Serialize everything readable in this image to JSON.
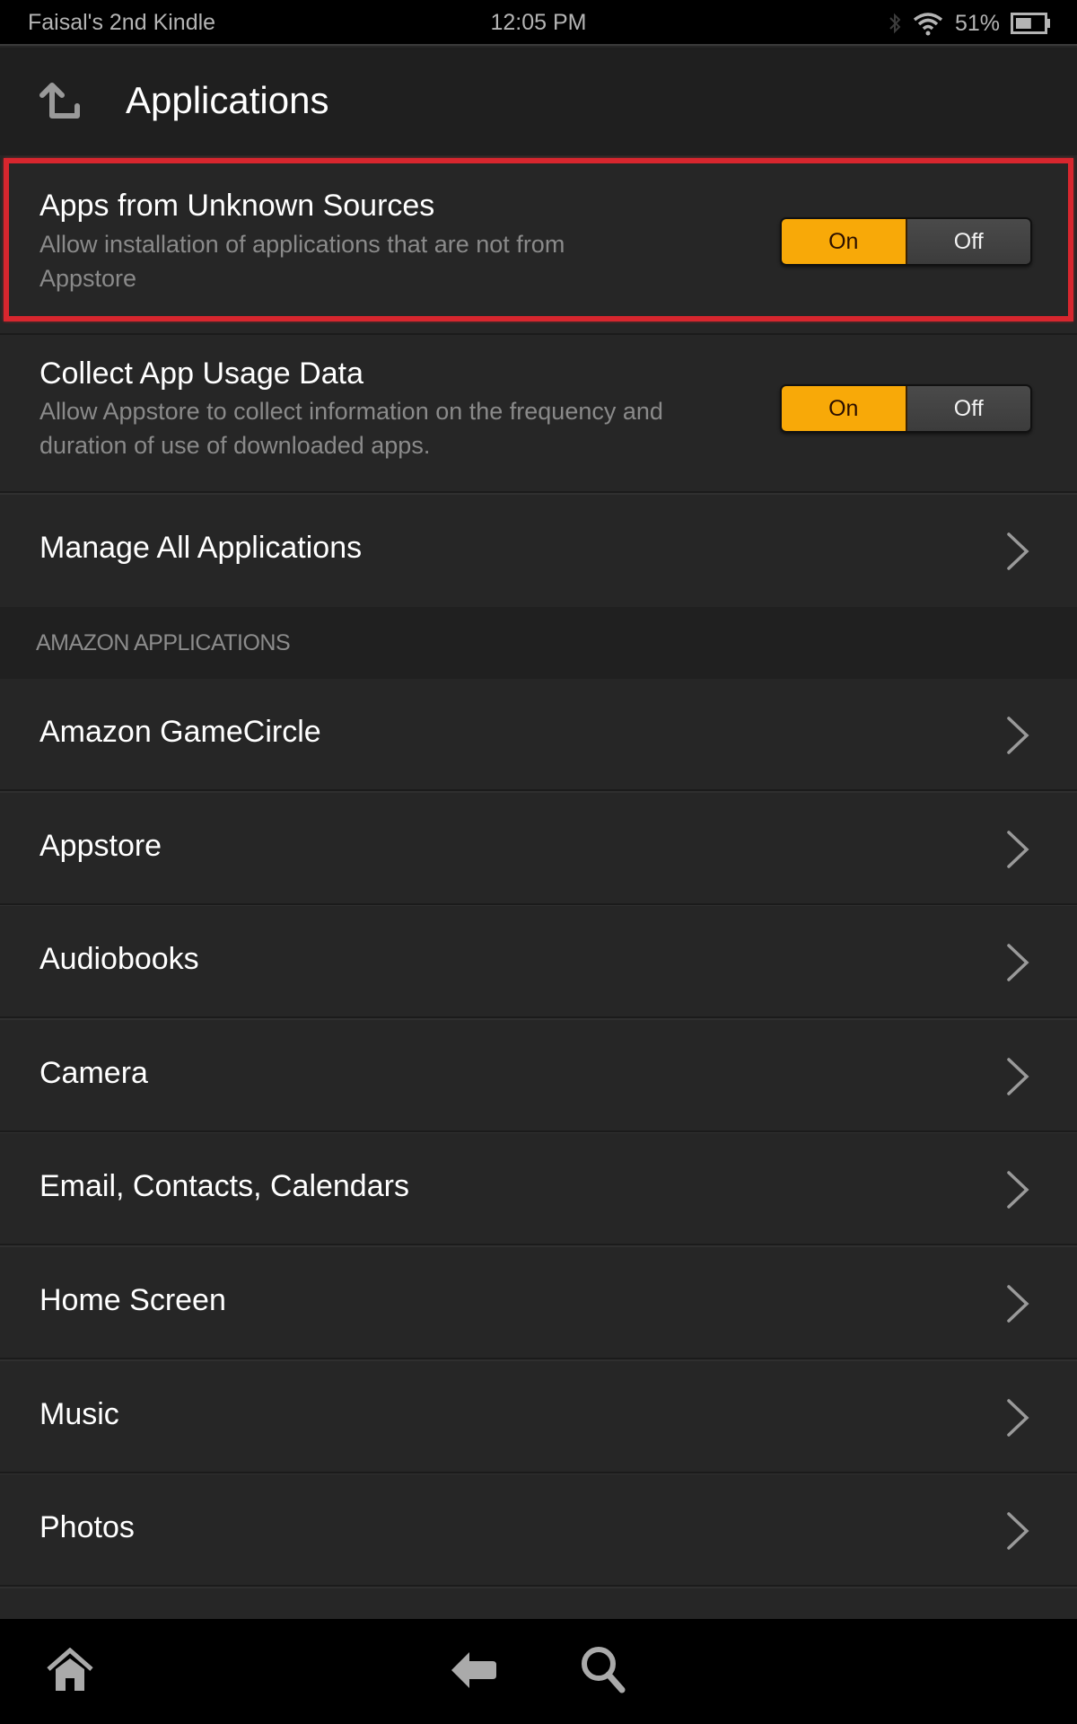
{
  "status_bar": {
    "device_name": "Faisal's 2nd Kindle",
    "time": "12:05 PM",
    "battery_percent": "51%",
    "battery_level": 0.51,
    "icons": [
      "bluetooth-icon",
      "wifi-icon",
      "battery-icon"
    ]
  },
  "header": {
    "title": "Applications",
    "up_icon": "up-arrow-icon"
  },
  "settings": [
    {
      "label": "Apps from Unknown Sources",
      "description": "Allow installation of applications that are not from Appstore",
      "toggle": {
        "on_label": "On",
        "off_label": "Off",
        "value": "On"
      },
      "highlighted": true
    },
    {
      "label": "Collect App Usage Data",
      "description": "Allow Appstore to collect information on the frequency and duration of use of downloaded apps.",
      "toggle": {
        "on_label": "On",
        "off_label": "Off",
        "value": "On"
      },
      "highlighted": false
    }
  ],
  "manage_all": {
    "label": "Manage All Applications"
  },
  "section": {
    "title": "AMAZON APPLICATIONS",
    "items": [
      {
        "label": "Amazon GameCircle"
      },
      {
        "label": "Appstore"
      },
      {
        "label": "Audiobooks"
      },
      {
        "label": "Camera"
      },
      {
        "label": "Email, Contacts, Calendars"
      },
      {
        "label": "Home Screen"
      },
      {
        "label": "Music"
      },
      {
        "label": "Photos"
      }
    ]
  },
  "nav_bar": {
    "buttons": [
      "home-icon",
      "back-icon",
      "search-icon"
    ]
  },
  "colors": {
    "accent": "#f8a908",
    "highlight": "#d7262e",
    "background": "#262626"
  }
}
